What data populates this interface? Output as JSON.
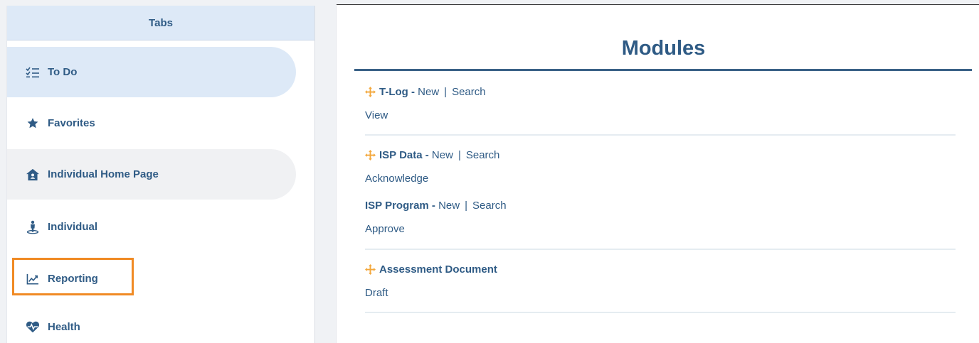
{
  "tabs": {
    "header": "Tabs",
    "items": [
      {
        "label": "To Do",
        "icon": "checklist-icon"
      },
      {
        "label": "Favorites",
        "icon": "star-icon"
      },
      {
        "label": "Individual Home Page",
        "icon": "home-icon"
      },
      {
        "label": "Individual",
        "icon": "person-icon"
      },
      {
        "label": "Reporting",
        "icon": "chart-line-icon"
      },
      {
        "label": "Health",
        "icon": "heartbeat-icon"
      }
    ]
  },
  "modules": {
    "title": "Modules",
    "tlog": {
      "name": "T-Log -",
      "new": "New",
      "sep": "|",
      "search": "Search",
      "sub": "View"
    },
    "isp_data": {
      "name": "ISP Data -",
      "new": "New",
      "sep": "|",
      "search": "Search",
      "sub": "Acknowledge"
    },
    "isp_program": {
      "name": "ISP Program -",
      "new": "New",
      "sep": "|",
      "search": "Search",
      "sub": "Approve"
    },
    "assessment": {
      "name": "Assessment Document",
      "sub": "Draft"
    }
  },
  "colors": {
    "accent_text": "#2f5b85",
    "active_tab_bg": "#dde9f7",
    "highlight": "#f08a24",
    "move_icon": "#f3a73b"
  }
}
